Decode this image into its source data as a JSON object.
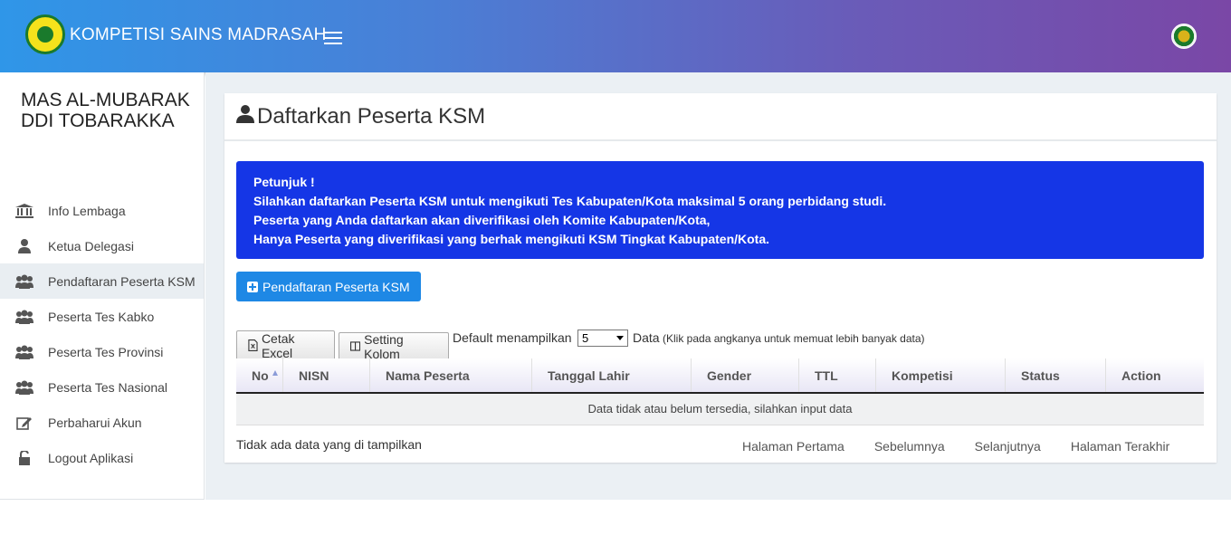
{
  "header": {
    "brand_title": "KOMPETISI SAINS MADRASAH",
    "logo_icon": "kemenag-logo-icon",
    "menu_icon": "hamburger-icon",
    "avatar_icon": "user-avatar-icon"
  },
  "sidebar": {
    "school_name": "MAS AL-MUBARAK DDI TOBARAKKA",
    "items": [
      {
        "label": "Info Lembaga",
        "icon": "institution-icon"
      },
      {
        "label": "Ketua Delegasi",
        "icon": "user-icon"
      },
      {
        "label": "Pendaftaran Peserta KSM",
        "icon": "users-icon",
        "active": true
      },
      {
        "label": "Peserta Tes Kabko",
        "icon": "users-icon"
      },
      {
        "label": "Peserta Tes Provinsi",
        "icon": "users-icon"
      },
      {
        "label": "Peserta Tes Nasional",
        "icon": "users-icon"
      },
      {
        "label": "Perbaharui Akun",
        "icon": "edit-icon"
      },
      {
        "label": "Logout Aplikasi",
        "icon": "unlock-icon"
      }
    ]
  },
  "main": {
    "title": "Daftarkan Peserta KSM",
    "alert": {
      "line1": "Petunjuk !",
      "line2": "Silahkan daftarkan Peserta KSM untuk mengikuti Tes Kabupaten/Kota maksimal 5 orang perbidang studi.",
      "line3": "Peserta yang Anda daftarkan akan diverifikasi oleh Komite Kabupaten/Kota,",
      "line4": "Hanya Peserta yang diverifikasi yang berhak mengikuti KSM Tingkat Kabupaten/Kota."
    },
    "register_button": "Pendaftaran Peserta KSM",
    "toolbar": {
      "excel_button": "Cetak Excel",
      "columns_button": "Setting Kolom",
      "show_label": "Default menampilkan",
      "page_size": "5",
      "data_label": "Data",
      "hint": "(Klik pada angkanya untuk memuat lebih banyak data)"
    },
    "table": {
      "columns": [
        "No",
        "NISN",
        "Nama Peserta",
        "Tanggal Lahir",
        "Gender",
        "TTL",
        "Kompetisi",
        "Status",
        "Action"
      ],
      "empty_message": "Data tidak atau belum tersedia, silahkan input data"
    },
    "info_text": "Tidak ada data yang di tampilkan",
    "pager": {
      "first": "Halaman Pertama",
      "prev": "Sebelumnya",
      "next": "Selanjutnya",
      "last": "Halaman Terakhir"
    }
  }
}
